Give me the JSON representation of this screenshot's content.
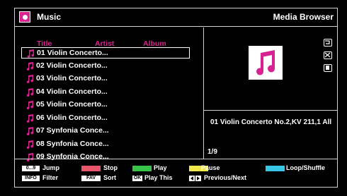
{
  "header": {
    "title": "Music",
    "right_title": "Media Browser",
    "icon": "music-note-icon",
    "accent": "#d6238f"
  },
  "columns": {
    "title": "Title",
    "artist": "Artist",
    "album": "Album"
  },
  "tracks": [
    "01 Violin Concerto...",
    "02 Violin Concerto...",
    "03 Violin Concerto...",
    "04 Violin Concerto...",
    "05 Violin Concerto...",
    "06 Violin Concerto...",
    "07 Synfonia Conce...",
    "08 Synfonia Conce...",
    "09 Synfonia Conce..."
  ],
  "selected_index": 0,
  "now_playing": {
    "info": "01 Violin Concerto No.2,KV 211,1 All",
    "count": "1/9"
  },
  "side_icons": [
    "repeat-icon",
    "shuffle-icon",
    "stop-icon"
  ],
  "legend": {
    "jump_key": "0...9",
    "jump_label": "Jump",
    "info_key": "INFO",
    "info_label": "Filter",
    "stop_label": "Stop",
    "stop_color": "#e8566b",
    "fav_key": "FAV",
    "sort_label": "Sort",
    "play_label": "Play",
    "play_color": "#39c24a",
    "ok_key": "OK",
    "play_this_label": "Play This",
    "pause_label": "Pause",
    "pause_color": "#f2e84b",
    "prev_next_label": "Previous/Next",
    "loop_label": "Loop/Shuffle",
    "loop_color": "#38c6e6"
  }
}
